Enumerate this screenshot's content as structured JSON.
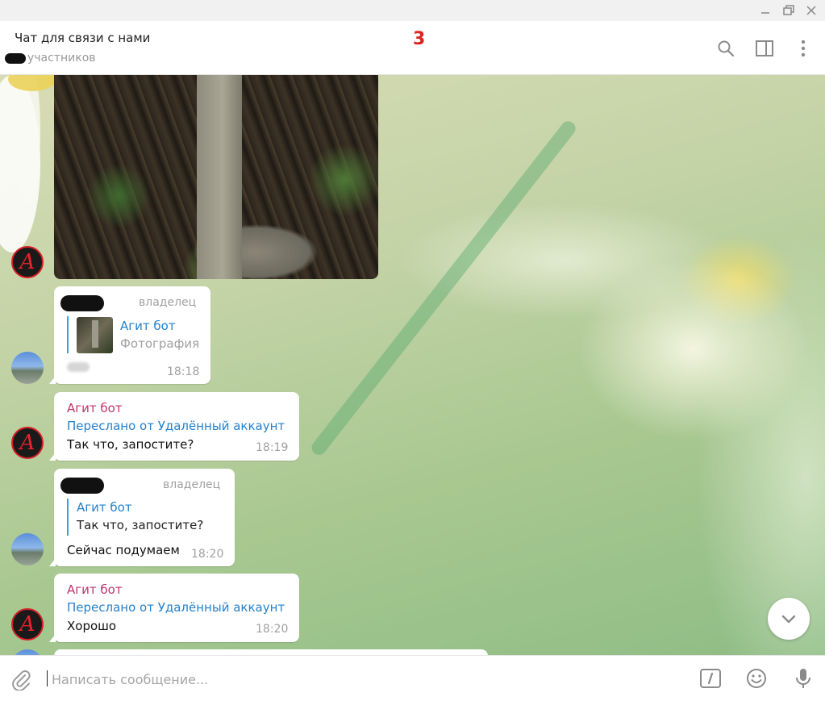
{
  "window": {
    "controls": [
      "minimize-icon",
      "restore-icon",
      "close-icon"
    ]
  },
  "header": {
    "title": "Чат для связи с нами",
    "subtitle": "участников",
    "annotation": "3",
    "icons": [
      "search-icon",
      "sidebar-toggle-icon",
      "more-vertical-icon"
    ]
  },
  "messages": [
    {
      "type": "photo",
      "sender": "Агит бот"
    },
    {
      "role": "владелец",
      "reply": {
        "name": "Агит бот",
        "text": "Фотография"
      },
      "time": "18:18"
    },
    {
      "sender": "Агит бот",
      "forwarded": "Переслано от Удалённый аккаунт",
      "text": "Так что, запостите?",
      "time": "18:19"
    },
    {
      "role": "владелец",
      "reply": {
        "name": "Агит бот",
        "text": "Так что, запостите?"
      },
      "text": "Сейчас подумаем",
      "time": "18:20"
    },
    {
      "sender": "Агит бот",
      "forwarded": "Переслано от Удалённый аккаунт",
      "text": "Хорошо",
      "time": "18:20"
    }
  ],
  "composer": {
    "placeholder": "Написать сообщение...",
    "icons": [
      "attach-icon",
      "bot-command-icon",
      "emoji-icon",
      "microphone-icon"
    ]
  },
  "colors": {
    "sender_name": "#c0336a",
    "link_blue": "#2481cc",
    "annotation_red": "#e02020",
    "avatar_border_red": "#d81f26"
  }
}
